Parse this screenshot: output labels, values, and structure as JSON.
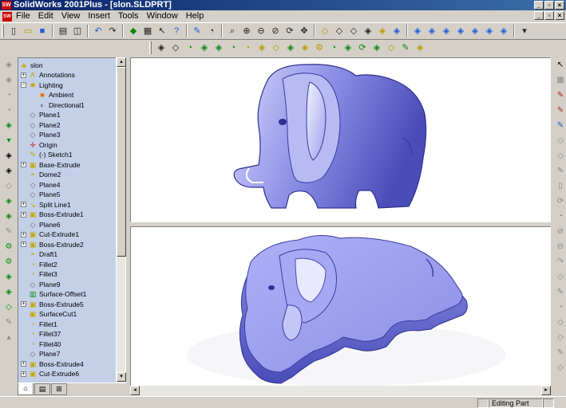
{
  "window": {
    "title": "SolidWorks 2001Plus - [slon.SLDPRT]",
    "app_icon_text": "SW",
    "minimize_glyph": "_",
    "restore_glyph": "▫",
    "close_glyph": "×"
  },
  "menu": {
    "items": [
      {
        "label": "File"
      },
      {
        "label": "Edit"
      },
      {
        "label": "View"
      },
      {
        "label": "Insert"
      },
      {
        "label": "Tools"
      },
      {
        "label": "Window"
      },
      {
        "label": "Help"
      }
    ]
  },
  "toolbar_icons": {
    "new": "▯",
    "open": "▭",
    "save": "■",
    "print": "▤",
    "preview": "◫",
    "undo": "↶",
    "redo": "↷",
    "select": "↖",
    "rebuild": "◆",
    "options": "▦",
    "help": "?",
    "zoom_fit": "⌕",
    "zoom_area": "⊕",
    "zoom_in": "⊖",
    "zoom_out": "⊘",
    "rotate": "⟳",
    "pan": "✥",
    "cube": "◈",
    "cube_alt": "◇",
    "sketch": "✎",
    "fillet": "◔",
    "gear": "⚙",
    "arrow_down": "▾",
    "arrow_up": "▴",
    "arrow_right": "▸",
    "arrow_left": "◂"
  },
  "tree": {
    "root": "slon",
    "items": [
      {
        "label": "Annotations",
        "expander": "+"
      },
      {
        "label": "Lighting",
        "expander": "−"
      },
      {
        "label": "Ambient",
        "expander": ""
      },
      {
        "label": "Directional1",
        "expander": ""
      },
      {
        "label": "Plane1",
        "expander": ""
      },
      {
        "label": "Plane2",
        "expander": ""
      },
      {
        "label": "Plane3",
        "expander": ""
      },
      {
        "label": "Origin",
        "expander": ""
      },
      {
        "label": "(-) Sketch1",
        "expander": ""
      },
      {
        "label": "Base-Extrude",
        "expander": "+"
      },
      {
        "label": "Dome2",
        "expander": ""
      },
      {
        "label": "Plane4",
        "expander": ""
      },
      {
        "label": "Plane5",
        "expander": ""
      },
      {
        "label": "Split Line1",
        "expander": "+"
      },
      {
        "label": "Boss-Extrude1",
        "expander": "+"
      },
      {
        "label": "Plane6",
        "expander": ""
      },
      {
        "label": "Cut-Extrude1",
        "expander": "+"
      },
      {
        "label": "Boss-Extrude2",
        "expander": "+"
      },
      {
        "label": "Draft1",
        "expander": ""
      },
      {
        "label": "Fillet2",
        "expander": ""
      },
      {
        "label": "Fillet3",
        "expander": ""
      },
      {
        "label": "Plane9",
        "expander": ""
      },
      {
        "label": "Surface-Offset1",
        "expander": ""
      },
      {
        "label": "Boss-Extrude5",
        "expander": "+"
      },
      {
        "label": "SurfaceCut1",
        "expander": ""
      },
      {
        "label": "Fillet1",
        "expander": ""
      },
      {
        "label": "Fillet37",
        "expander": ""
      },
      {
        "label": "Fillet40",
        "expander": ""
      },
      {
        "label": "Plane7",
        "expander": ""
      },
      {
        "label": "Boss-Extrude4",
        "expander": "+"
      },
      {
        "label": "Cut-Extrude6",
        "expander": "+"
      }
    ]
  },
  "tree_tab_icons": {
    "feature_manager": "⌂",
    "property_manager": "▤",
    "config_manager": "⊞"
  },
  "status": {
    "cell_1": "",
    "cell_2": "",
    "mode": "Editing Part"
  },
  "colors": {
    "title_bar": "#0a246a",
    "tree_bg": "#c3d0e8",
    "model_base": "#8c8fe6",
    "model_light": "#d6d8fb",
    "model_dark": "#4a4db8"
  }
}
